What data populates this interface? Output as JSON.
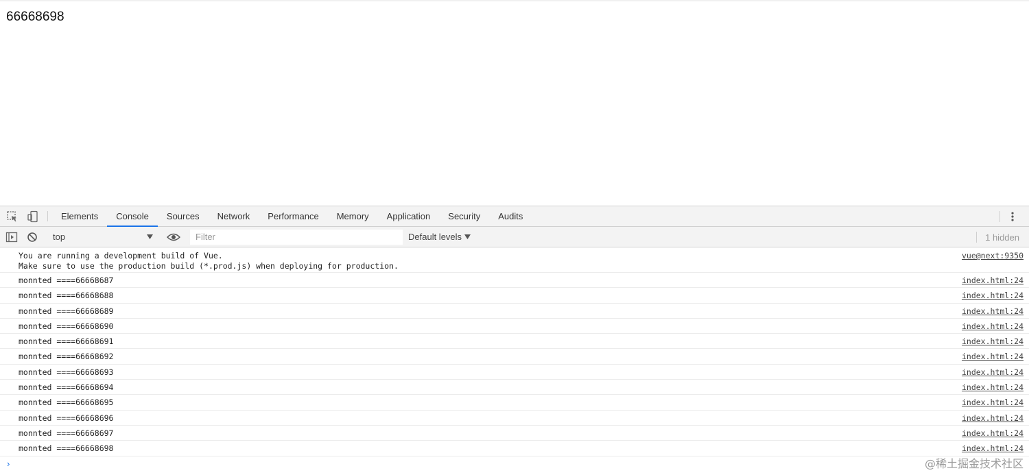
{
  "page": {
    "value": "66668698"
  },
  "devtools": {
    "tabs": [
      {
        "label": "Elements"
      },
      {
        "label": "Console"
      },
      {
        "label": "Sources"
      },
      {
        "label": "Network"
      },
      {
        "label": "Performance"
      },
      {
        "label": "Memory"
      },
      {
        "label": "Application"
      },
      {
        "label": "Security"
      },
      {
        "label": "Audits"
      }
    ],
    "active_tab": "Console",
    "accent_color": "#1a73e8"
  },
  "toolbar": {
    "context": "top",
    "filter_placeholder": "Filter",
    "levels_label": "Default levels",
    "hidden_count": "1 hidden"
  },
  "console": {
    "vue_warning": {
      "line1": "You are running a development build of Vue.",
      "line2": "Make sure to use the production build (*.prod.js) when deploying for production.",
      "source": "vue@next:9350"
    },
    "messages": [
      {
        "text": "monnted ====66668687",
        "source": "index.html:24"
      },
      {
        "text": "monnted ====66668688",
        "source": "index.html:24"
      },
      {
        "text": "monnted ====66668689",
        "source": "index.html:24"
      },
      {
        "text": "monnted ====66668690",
        "source": "index.html:24"
      },
      {
        "text": "monnted ====66668691",
        "source": "index.html:24"
      },
      {
        "text": "monnted ====66668692",
        "source": "index.html:24"
      },
      {
        "text": "monnted ====66668693",
        "source": "index.html:24"
      },
      {
        "text": "monnted ====66668694",
        "source": "index.html:24"
      },
      {
        "text": "monnted ====66668695",
        "source": "index.html:24"
      },
      {
        "text": "monnted ====66668696",
        "source": "index.html:24"
      },
      {
        "text": "monnted ====66668697",
        "source": "index.html:24"
      },
      {
        "text": "monnted ====66668698",
        "source": "index.html:24"
      }
    ],
    "prompt_symbol": "›"
  },
  "watermark": "@稀土掘金技术社区"
}
